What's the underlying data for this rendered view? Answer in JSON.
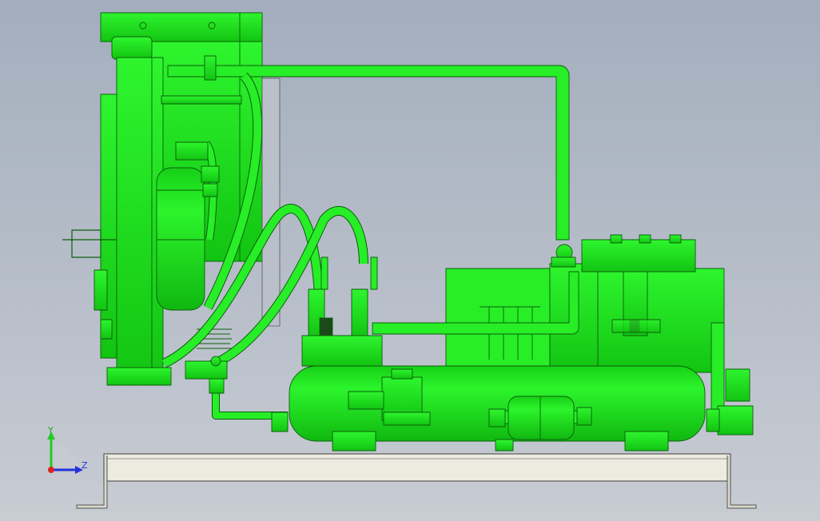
{
  "viewport": {
    "background_top": "#a3aebd",
    "background_bottom": "#c8ccd3"
  },
  "model": {
    "part_color": "#22ee22",
    "part_shade": "#14c814",
    "edge_color": "#0b5e0b",
    "base_color": "#ecebe0",
    "base_edge": "#5a5a5a"
  },
  "triad": {
    "y_label": "Y",
    "z_label": "Z",
    "y_color": "#22cc22",
    "z_color": "#2233dd",
    "x_color": "#dd2222",
    "icon": "coordinate-triad-icon"
  }
}
